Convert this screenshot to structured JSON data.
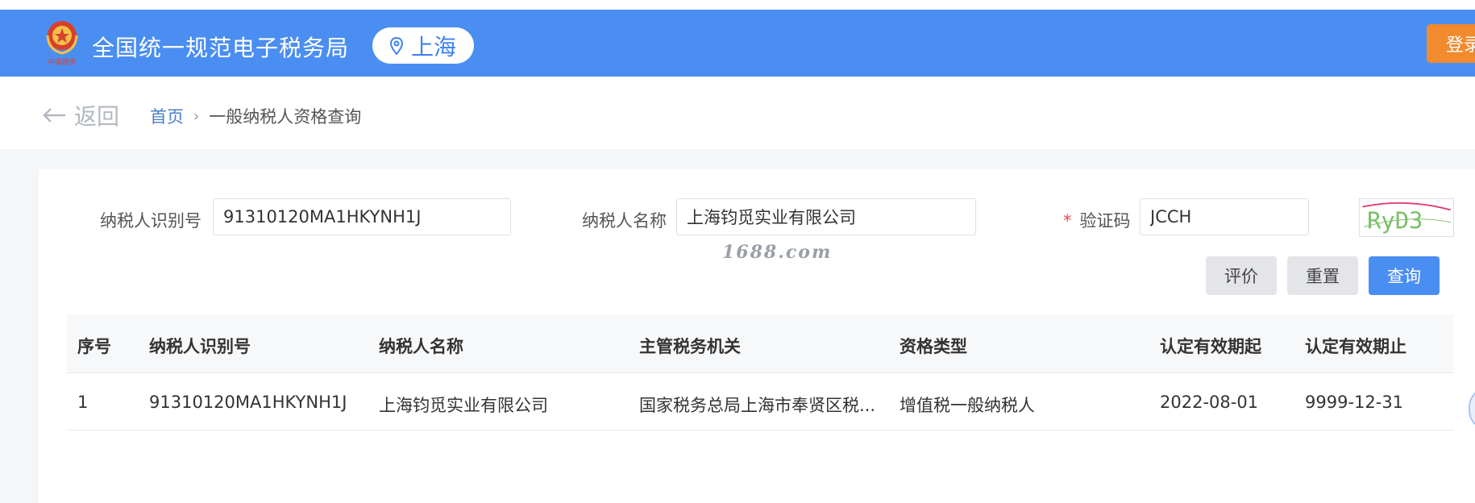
{
  "header": {
    "site_title": "全国统一规范电子税务局",
    "location": "上海",
    "login_label": "登录",
    "brand_color": "#4b8ef1",
    "emblem_text": "中国税务"
  },
  "navbar": {
    "back_label": "返回",
    "breadcrumb": {
      "home": "首页",
      "separator": "›",
      "current": "一般纳税人资格查询"
    }
  },
  "form": {
    "taxpayer_id": {
      "label": "纳税人识别号",
      "value": "91310120MA1HKYNH1J"
    },
    "taxpayer_name": {
      "label": "纳税人名称",
      "value": "上海钧觅实业有限公司"
    },
    "captcha": {
      "required_mark": "*",
      "label": "验证码",
      "value": "JCCH",
      "image_text": "RyD3"
    },
    "buttons": {
      "evaluate": "评价",
      "reset": "重置",
      "query": "查询"
    }
  },
  "watermark": "1688.com",
  "table": {
    "columns": [
      "序号",
      "纳税人识别号",
      "纳税人名称",
      "主管税务机关",
      "资格类型",
      "认定有效期起",
      "认定有效期止"
    ],
    "rows": [
      [
        "1",
        "91310120MA1HKYNH1J",
        "上海钧觅实业有限公司",
        "国家税务总局上海市奉贤区税...",
        "增值税一般纳税人",
        "2022-08-01",
        "9999-12-31"
      ]
    ]
  }
}
